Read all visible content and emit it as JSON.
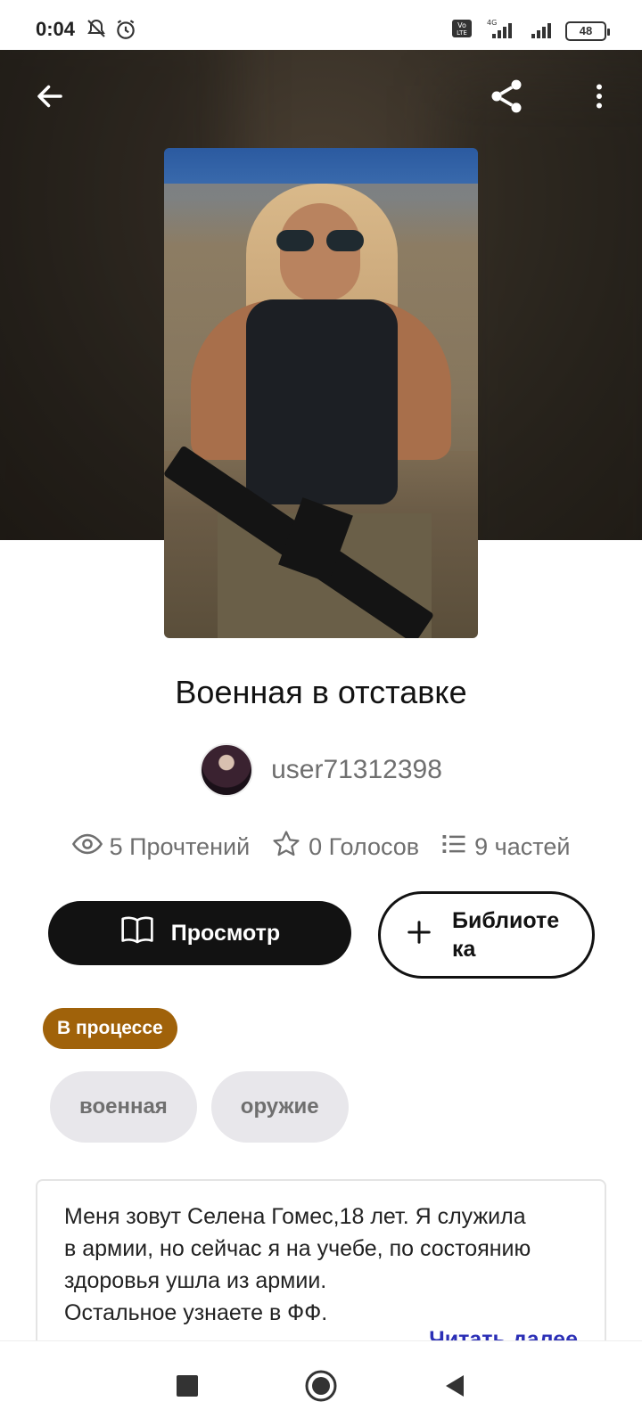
{
  "status_bar": {
    "time": "0:04",
    "network": "4G",
    "lte_label": "Vo LTE",
    "battery": "48"
  },
  "story": {
    "title": "Военная в отставке",
    "author": "user71312398",
    "stats": {
      "reads": "5 Прочтений",
      "votes": "0 Голосов",
      "parts": "9 частей"
    },
    "read_button": "Просмотр",
    "library_button": "Библиотека",
    "status": "В процессе",
    "tags": [
      "военная",
      "оружие"
    ],
    "description": [
      "Меня зовут Селена Гомес,18 лет. Я служила",
      "в армии, но сейчас я на учебе, по состоянию",
      "здоровья ушла из армии.",
      "Остальное узнаете в ФФ."
    ],
    "read_more": "Читать далее"
  },
  "colors": {
    "accent_status": "#a0620a",
    "read_more_link": "#2b2fb6",
    "primary_button": "#121212"
  },
  "icons": {
    "back": "arrow-left-icon",
    "share": "share-icon",
    "more": "more-vertical-icon",
    "reads": "eye-icon",
    "votes": "star-icon",
    "parts": "list-icon",
    "read": "book-open-icon",
    "library": "plus-icon"
  }
}
